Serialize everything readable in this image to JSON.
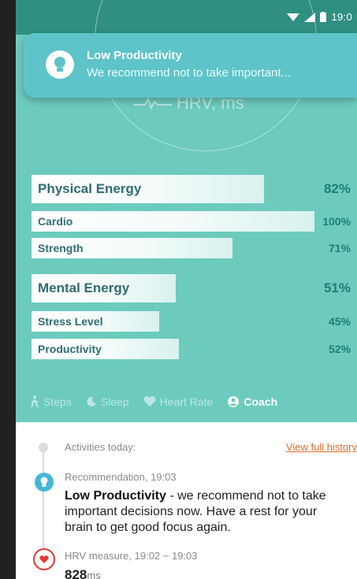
{
  "status_bar": {
    "time": "19:0"
  },
  "notification": {
    "icon": "lightbulb-icon",
    "title": "Low Productivity",
    "text": "We recommend not to take important..."
  },
  "hrv_caption": {
    "label": "HRV, ms"
  },
  "energy": {
    "physical": {
      "label": "Physical Energy",
      "pct_text": "82%",
      "value": 82
    },
    "cardio": {
      "label": "Cardio",
      "pct_text": "100%",
      "value": 100
    },
    "strength": {
      "label": "Strength",
      "pct_text": "71%",
      "value": 71
    },
    "mental": {
      "label": "Mental Energy",
      "pct_text": "51%",
      "value": 51
    },
    "stress": {
      "label": "Stress Level",
      "pct_text": "45%",
      "value": 45
    },
    "productivity": {
      "label": "Productivity",
      "pct_text": "52%",
      "value": 52
    }
  },
  "tabs": [
    {
      "label": "Steps",
      "icon": "walking-icon",
      "active": false
    },
    {
      "label": "Sleep",
      "icon": "moon-icon",
      "active": false
    },
    {
      "label": "Heart Rate",
      "icon": "heart-icon",
      "active": false
    },
    {
      "label": "Coach",
      "icon": "coach-icon",
      "active": true
    }
  ],
  "feed": {
    "activities_label": "Activities today:",
    "history_link": "View full history",
    "recommendation_meta": "Recommendation, 19:03",
    "recommendation_title": "Low Productivity",
    "recommendation_text": " - we recommend not to take important decisions now. Have a rest for your brain to get good focus again.",
    "hrv_meta": "HRV measure, 19:02 ~ 19:03",
    "hrv_value": "828",
    "hrv_unit": "ms"
  },
  "colors": {
    "background": "#6ccbbd",
    "status_bar": "#2f8f81",
    "notification": "#5ec4c9",
    "accent_link": "#e36c2e",
    "heart": "#e53935"
  }
}
